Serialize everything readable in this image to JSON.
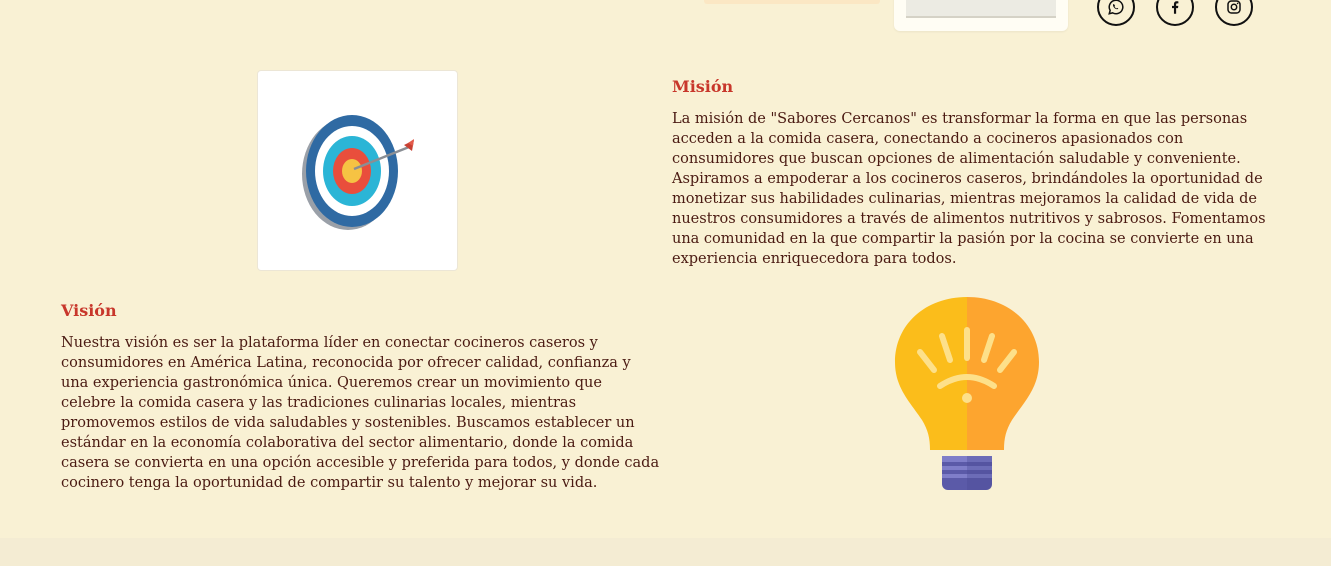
{
  "header": {
    "social": [
      {
        "name": "whatsapp-icon"
      },
      {
        "name": "facebook-icon"
      },
      {
        "name": "instagram-icon"
      }
    ]
  },
  "mision": {
    "title": "Misión",
    "text": "La misión de \"Sabores Cercanos\" es transformar la forma en que las personas acceden a la comida casera, conectando a cocineros apasionados con consumidores que buscan opciones de alimentación saludable y conveniente. Aspiramos a empoderar a los cocineros caseros, brindándoles la oportunidad de monetizar sus habilidades culinarias, mientras mejoramos la calidad de vida de nuestros consumidores a través de alimentos nutritivos y sabrosos. Fomentamos una comunidad en la que compartir la pasión por la cocina se convierte en una experiencia enriquecedora para todos.",
    "image_icon": "target-icon"
  },
  "vision": {
    "title": "Visión",
    "text": "Nuestra visión es ser la plataforma líder en conectar cocineros caseros y consumidores en América Latina, reconocida por ofrecer calidad, confianza y una experiencia gastronómica única. Queremos crear un movimiento que celebre la comida casera y las tradiciones culinarias locales, mientras promovemos estilos de vida saludables y sostenibles. Buscamos establecer un estándar en la economía colaborativa del sector alimentario, donde la comida casera se convierta en una opción accesible y preferida para todos, y donde cada cocinero tenga la oportunidad de compartir su talento y mejorar su vida.",
    "image_icon": "lightbulb-icon"
  },
  "colors": {
    "background": "#f9f1d4",
    "heading": "#c8372b",
    "text": "#4a1a12"
  }
}
